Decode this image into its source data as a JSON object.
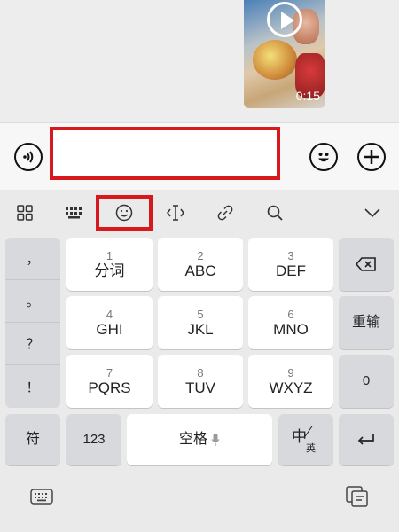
{
  "chat": {
    "video_duration": "0:15"
  },
  "input": {
    "text_value": ""
  },
  "toolbar": {
    "items": [
      "grid-icon",
      "keyboard-icon",
      "emoji-icon",
      "cursor-icon",
      "link-icon",
      "search-icon",
      "chevron-down-icon"
    ]
  },
  "keyboard": {
    "side_punct": [
      "，",
      "。",
      "？",
      "！"
    ],
    "keys": [
      {
        "num": "1",
        "label": "分词"
      },
      {
        "num": "2",
        "label": "ABC"
      },
      {
        "num": "3",
        "label": "DEF"
      },
      {
        "num": "4",
        "label": "GHI"
      },
      {
        "num": "5",
        "label": "JKL"
      },
      {
        "num": "6",
        "label": "MNO"
      },
      {
        "num": "7",
        "label": "PQRS"
      },
      {
        "num": "8",
        "label": "TUV"
      },
      {
        "num": "9",
        "label": "WXYZ"
      }
    ],
    "reinput": "重输",
    "zero": "0",
    "symbol": "符",
    "num_toggle": "123",
    "space": "空格",
    "lang_main": "中",
    "lang_sub": "英"
  },
  "colors": {
    "highlight": "#d7191d"
  }
}
